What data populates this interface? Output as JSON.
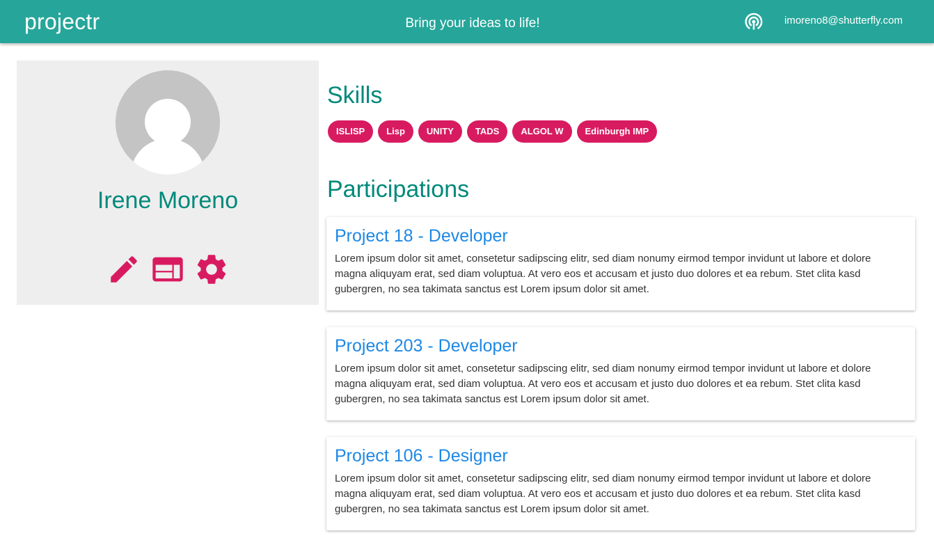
{
  "header": {
    "brand": "projectr",
    "tagline": "Bring your ideas to life!",
    "podcast_icon": "podcast-icon",
    "user_email": "imoreno8@shutterfly.com"
  },
  "profile": {
    "avatar_icon": "person-icon",
    "name": "Irene Moreno",
    "actions": [
      {
        "icon": "pencil-icon",
        "label": "edit"
      },
      {
        "icon": "web-layout-icon",
        "label": "web"
      },
      {
        "icon": "gear-icon",
        "label": "settings"
      }
    ]
  },
  "skills": {
    "title": "Skills",
    "items": [
      "ISLISP",
      "Lisp",
      "UNITY",
      "TADS",
      "ALGOL W",
      "Edinburgh IMP"
    ]
  },
  "participations": {
    "title": "Participations",
    "items": [
      {
        "title": "Project 18 - Developer",
        "description": "Lorem ipsum dolor sit amet, consetetur sadipscing elitr, sed diam nonumy eirmod tempor invidunt ut labore et dolore magna aliquyam erat, sed diam voluptua. At vero eos et accusam et justo duo dolores et ea rebum. Stet clita kasd gubergren, no sea takimata sanctus est Lorem ipsum dolor sit amet."
      },
      {
        "title": "Project 203 - Developer",
        "description": "Lorem ipsum dolor sit amet, consetetur sadipscing elitr, sed diam nonumy eirmod tempor invidunt ut labore et dolore magna aliquyam erat, sed diam voluptua. At vero eos et accusam et justo duo dolores et ea rebum. Stet clita kasd gubergren, no sea takimata sanctus est Lorem ipsum dolor sit amet."
      },
      {
        "title": "Project 106 - Designer",
        "description": "Lorem ipsum dolor sit amet, consetetur sadipscing elitr, sed diam nonumy eirmod tempor invidunt ut labore et dolore magna aliquyam erat, sed diam voluptua. At vero eos et accusam et justo duo dolores et ea rebum. Stet clita kasd gubergren, no sea takimata sanctus est Lorem ipsum dolor sit amet."
      }
    ]
  },
  "colors": {
    "header": "#26a69a",
    "heading": "#00897b",
    "accent": "#d81b60",
    "link": "#1e88e5",
    "panel": "#eeeeee"
  }
}
